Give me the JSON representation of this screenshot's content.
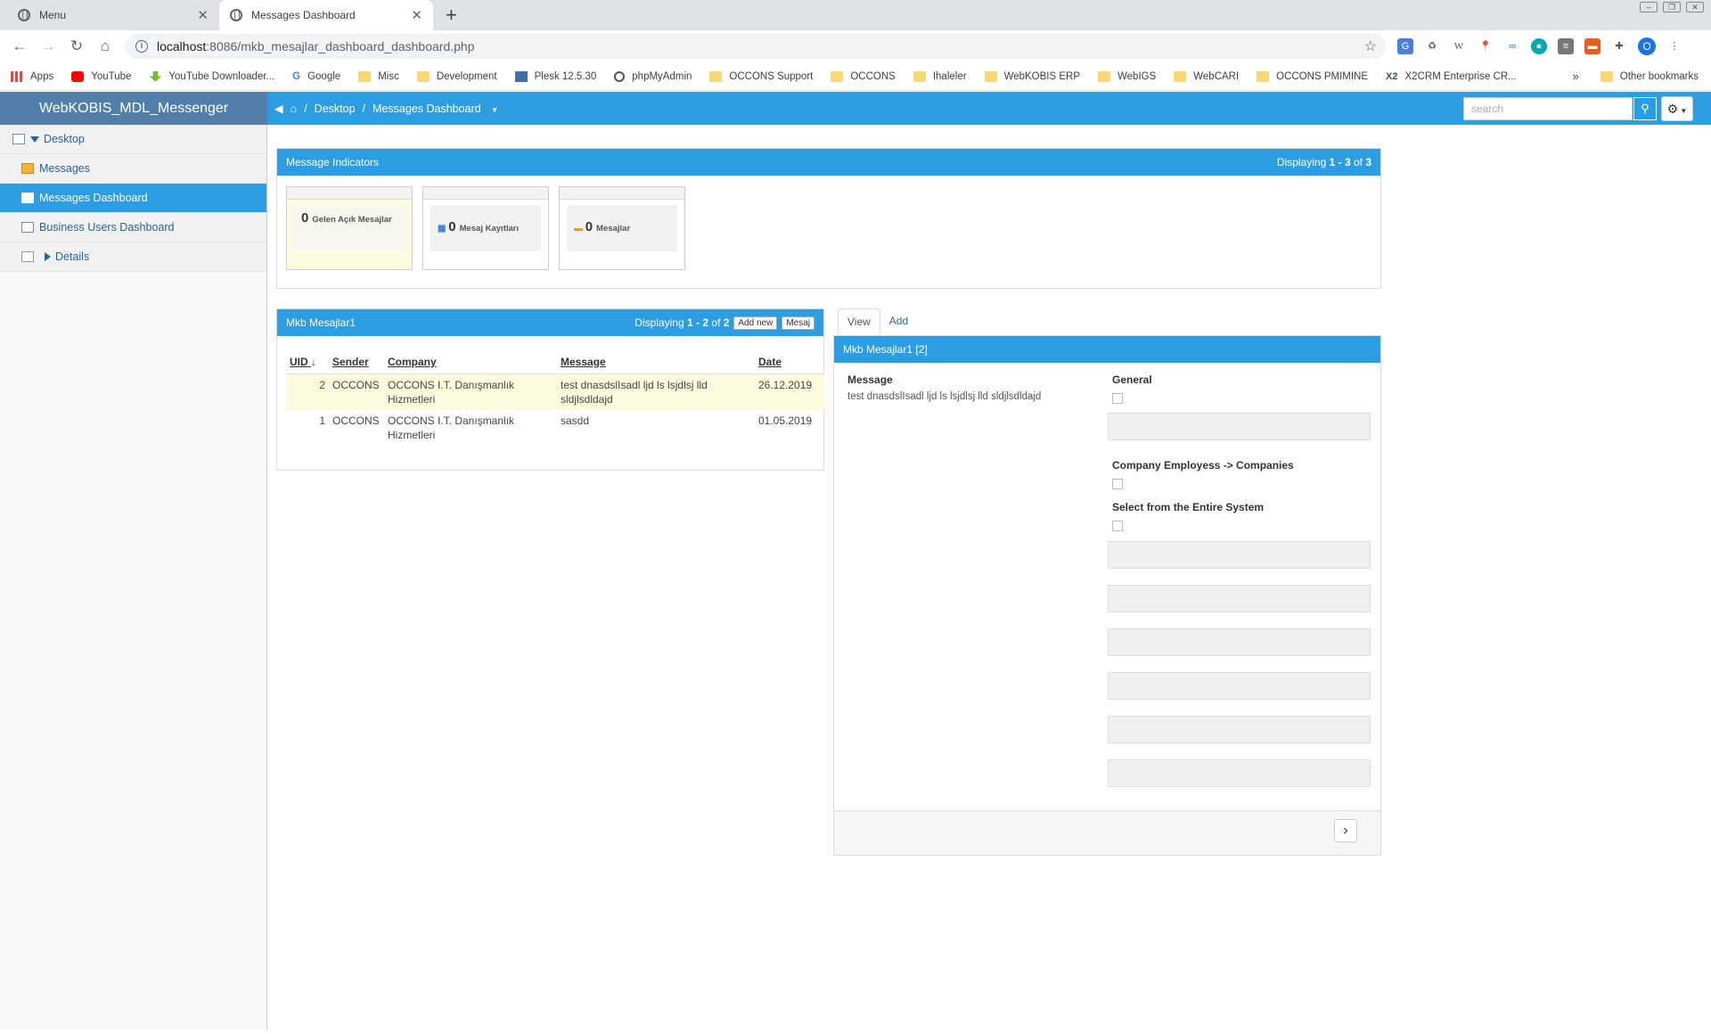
{
  "browser": {
    "tabs": [
      {
        "title": "Menu",
        "active": false
      },
      {
        "title": "Messages Dashboard",
        "active": true
      }
    ],
    "url_host": "localhost",
    "url_path": ":8086/mkb_mesajlar_dashboard_dashboard.php",
    "bookmarks": [
      "Apps",
      "YouTube",
      "YouTube Downloader...",
      "Google",
      "Misc",
      "Development",
      "Plesk 12.5.30",
      "phpMyAdmin",
      "OCCONS Support",
      "OCCONS",
      "Ihaleler",
      "WebKOBIS ERP",
      "WebIGS",
      "WebCARI",
      "OCCONS PMIMINE",
      "X2CRM Enterprise CR..."
    ],
    "other_bookmarks": "Other bookmarks",
    "profile_initial": "O"
  },
  "app": {
    "title": "WebKOBIS_MDL_Messenger",
    "breadcrumb": {
      "sep": "/",
      "desktop": "Desktop",
      "current": "Messages Dashboard"
    },
    "search_placeholder": "search"
  },
  "sidebar": {
    "items": [
      {
        "label": "Desktop"
      },
      {
        "label": "Messages"
      },
      {
        "label": "Messages Dashboard"
      },
      {
        "label": "Business Users Dashboard"
      },
      {
        "label": "Details"
      }
    ]
  },
  "indicators": {
    "title": "Message Indicators",
    "displaying_prefix": "Displaying ",
    "displaying_range": "1 - 3",
    "displaying_of": " of ",
    "displaying_total": "3",
    "cards": [
      {
        "count": "0",
        "label": "Gelen Açık Mesajlar"
      },
      {
        "count": "0",
        "label": "Mesaj Kayıtları"
      },
      {
        "count": "0",
        "label": "Mesajlar"
      }
    ]
  },
  "grid": {
    "title": "Mkb Mesajlar1",
    "displaying_prefix": "Displaying ",
    "displaying_range": "1 - 2",
    "displaying_of": " of ",
    "displaying_total": "2",
    "add_new_label": "Add new",
    "mesaj_label": "Mesaj",
    "columns": [
      "UID",
      "Sender",
      "Company",
      "Message",
      "Date"
    ],
    "rows": [
      {
        "uid": "2",
        "sender": "OCCONS",
        "company": "OCCONS I.T. Danışmanlık Hizmetleri",
        "message": "test dnasdslIsadl ljd ls lsjdlsj lld sldjlsdldajd",
        "date": "26.12.2019"
      },
      {
        "uid": "1",
        "sender": "OCCONS",
        "company": "OCCONS I.T. Danışmanlık Hizmetleri",
        "message": "sasdd",
        "date": "01.05.2019"
      }
    ]
  },
  "detail": {
    "tab_view": "View",
    "tab_add": "Add",
    "title": "Mkb Mesajlar1 [2]",
    "message_label": "Message",
    "message_value": "test dnasdslIsadl ljd ls lsjdlsj lld sldjlsdldajd",
    "general_label": "General",
    "employess_label": "Company Employess -> Companies",
    "entire_system_label": "Select from the Entire System"
  }
}
